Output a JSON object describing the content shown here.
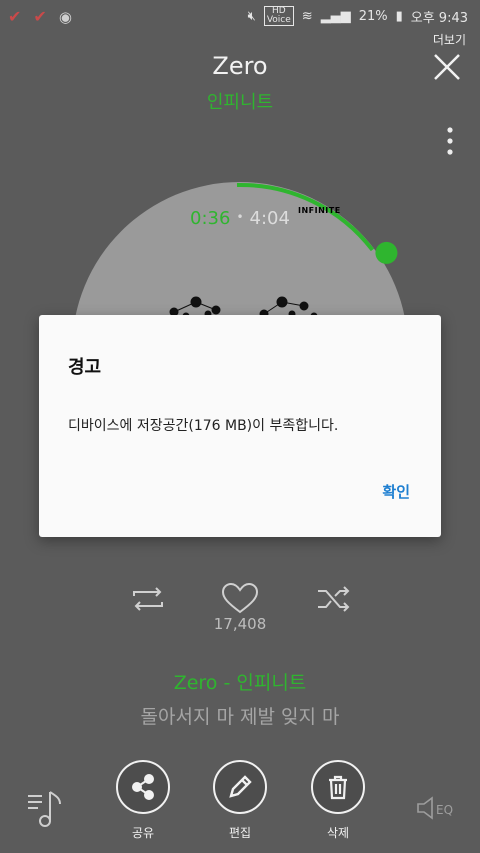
{
  "status_bar": {
    "hd_label": "HD",
    "voice_label": "Voice",
    "battery_percent": "21%",
    "time": "오후 9:43"
  },
  "header": {
    "more_label": "더보기",
    "song_title": "Zero",
    "artist": "인피니트"
  },
  "player": {
    "current_time": "0:36",
    "total_time": "4:04",
    "album_logo_text": "INFINITE",
    "progress_fraction": 0.147,
    "likes": "17,408"
  },
  "now_playing": {
    "track_line": "Zero - 인피니트",
    "lyric": "돌아서지 마 제발 잊지 마"
  },
  "dialog": {
    "title": "경고",
    "message": "디바이스에 저장공간(176 MB)이 부족합니다.",
    "ok_label": "확인"
  },
  "bottom_actions": {
    "share": "공유",
    "edit": "편집",
    "delete": "삭제",
    "eq": "EQ"
  },
  "colors": {
    "accent_green": "#2fb52f",
    "dialog_button_blue": "#1e7fd1",
    "background": "#5b5b5b"
  }
}
